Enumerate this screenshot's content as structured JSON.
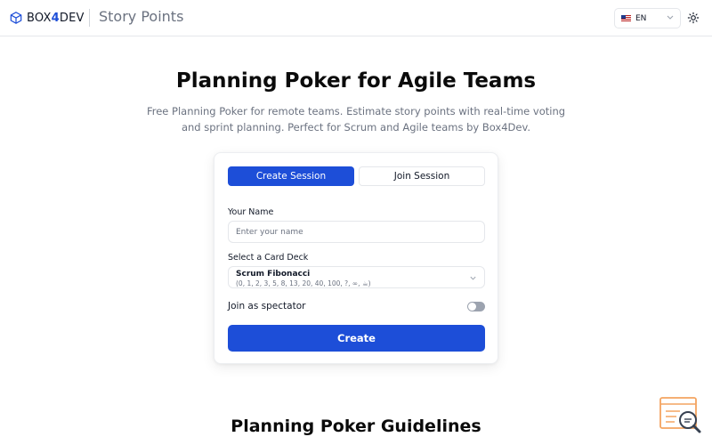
{
  "header": {
    "logo_prefix": "BOX",
    "logo_mid": "4",
    "logo_suffix": "DEV",
    "app_title": "Story Points",
    "language": "EN"
  },
  "hero": {
    "title": "Planning Poker for Agile Teams",
    "subtitle": "Free Planning Poker for remote teams. Estimate story points with real-time voting and sprint planning. Perfect for Scrum and Agile teams by Box4Dev."
  },
  "form": {
    "tabs": [
      {
        "label": "Create Session",
        "active": true
      },
      {
        "label": "Join Session",
        "active": false
      }
    ],
    "name_label": "Your Name",
    "name_placeholder": "Enter your name",
    "name_value": "",
    "deck_label": "Select a Card Deck",
    "deck_selected_name": "Scrum Fibonacci",
    "deck_selected_values": "(0, 1, 2, 3, 5, 8, 13, 20, 40, 100, ?, ∞, ☕)",
    "spectator_label": "Join as spectator",
    "spectator_enabled": false,
    "submit_label": "Create"
  },
  "guidelines": {
    "title": "Planning Poker Guidelines"
  },
  "icons": {
    "logo": "cube-icon",
    "flag": "us-flag-icon",
    "theme": "sun-icon",
    "help": "search-help-icon"
  },
  "colors": {
    "primary": "#1d4ed8",
    "muted_text": "#6b7280",
    "border": "#e5e7eb",
    "help_accent": "#f4a460"
  }
}
